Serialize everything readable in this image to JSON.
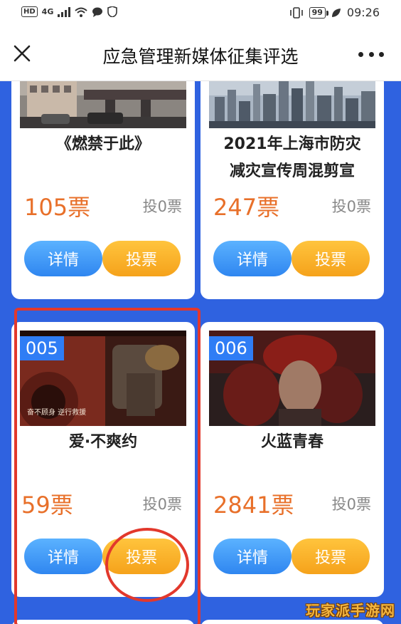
{
  "status_bar": {
    "hd": "HD",
    "network": "4G",
    "battery": "99",
    "time": "09:26"
  },
  "header": {
    "title": "应急管理新媒体征集评选",
    "close_icon": "close-icon",
    "more_icon": "more-icon"
  },
  "cards": [
    {
      "badge": "",
      "title_lines": [
        "《燃禁于此》",
        ""
      ],
      "votes": "105票",
      "voted": "投0票",
      "detail_label": "详情",
      "vote_label": "投票",
      "thumb_caption": ""
    },
    {
      "badge": "",
      "title_lines": [
        "2021年上海市防灾",
        "减灾宣传周混剪宣"
      ],
      "votes": "247票",
      "voted": "投0票",
      "detail_label": "详情",
      "vote_label": "投票",
      "thumb_caption": ""
    },
    {
      "badge": "005",
      "title_lines": [
        "爱·不爽约",
        ""
      ],
      "votes": "59票",
      "voted": "投0票",
      "detail_label": "详情",
      "vote_label": "投票",
      "thumb_caption": "奋不顾身 逆行救援"
    },
    {
      "badge": "006",
      "title_lines": [
        "火蓝青春",
        ""
      ],
      "votes": "2841票",
      "voted": "投0票",
      "detail_label": "详情",
      "vote_label": "投票",
      "thumb_caption": ""
    }
  ],
  "watermark": "玩家派手游网",
  "colors": {
    "background_blue": "#2f62e0",
    "badge_blue": "#2f7df5",
    "vote_count_orange": "#e8702a",
    "detail_button_blue": "#2f86f0",
    "vote_button_orange": "#f5a21b",
    "highlight_red": "#e2382c"
  }
}
